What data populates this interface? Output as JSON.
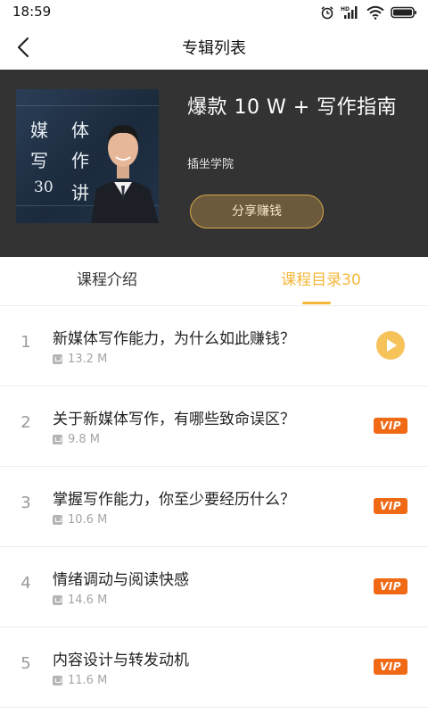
{
  "status_bar": {
    "time": "18:59",
    "icons": [
      "alarm-icon",
      "hd-signal-icon",
      "wifi-icon",
      "battery-icon"
    ]
  },
  "nav": {
    "title": "专辑列表",
    "back_icon": "back-arrow-icon"
  },
  "album": {
    "cover_text": [
      "媒",
      "体",
      "写",
      "作",
      "30",
      "讲"
    ],
    "title": "爆款 10 W + 写作指南",
    "author": "插坐学院",
    "share_label": "分享赚钱"
  },
  "tabs": [
    {
      "label": "课程介绍",
      "active": false
    },
    {
      "label": "课程目录30",
      "active": true
    }
  ],
  "lessons": [
    {
      "index": "1",
      "title": "新媒体写作能力，为什么如此赚钱？",
      "size": "13.2 M",
      "action": "play"
    },
    {
      "index": "2",
      "title": "关于新媒体写作，有哪些致命误区？",
      "size": "9.8 M",
      "action": "vip"
    },
    {
      "index": "3",
      "title": "掌握写作能力，你至少要经历什么？",
      "size": "10.6 M",
      "action": "vip"
    },
    {
      "index": "4",
      "title": "情绪调动与阅读快感",
      "size": "14.6 M",
      "action": "vip"
    },
    {
      "index": "5",
      "title": "内容设计与转发动机",
      "size": "11.6 M",
      "action": "vip"
    }
  ],
  "vip_label": "VIP",
  "colors": {
    "accent": "#f4b73a",
    "header_bg": "#333333",
    "vip": "#f06a16",
    "share_border": "#d8a84c"
  }
}
